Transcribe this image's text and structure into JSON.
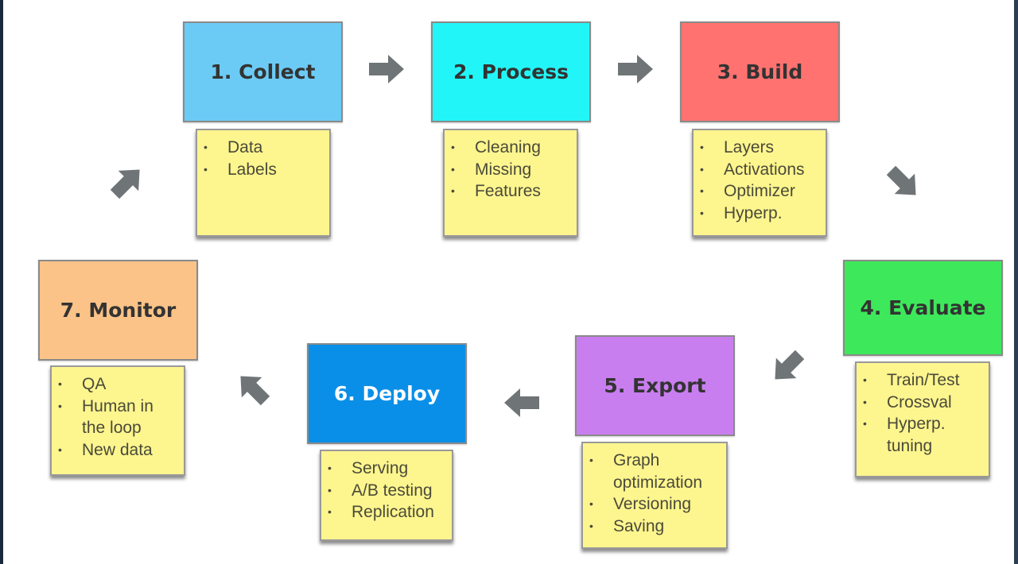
{
  "stages": [
    {
      "title": "1. Collect",
      "color": "#6ccbf5",
      "items": [
        "Data",
        "Labels"
      ]
    },
    {
      "title": "2. Process",
      "color": "#22f5f7",
      "items": [
        "Cleaning",
        "Missing",
        "Features"
      ]
    },
    {
      "title": "3. Build",
      "color": "#ff7270",
      "items": [
        "Layers",
        "Activations",
        "Optimizer",
        "Hyperp."
      ]
    },
    {
      "title": "4. Evaluate",
      "color": "#3de85a",
      "items": [
        "Train/Test",
        "Crossval",
        "Hyperp. tuning"
      ]
    },
    {
      "title": "5. Export",
      "color": "#c97ef0",
      "items": [
        "Graph optimization",
        "Versioning",
        "Saving"
      ]
    },
    {
      "title": "6. Deploy",
      "color": "#0a8fe8",
      "items": [
        "Serving",
        "A/B testing",
        "Replication"
      ]
    },
    {
      "title": "7. Monitor",
      "color": "#fbc387",
      "items": [
        "QA",
        "Human in the loop",
        "New data"
      ]
    }
  ],
  "note_color": "#fdf58e",
  "arrow_color": "#6f7476",
  "arrow_icon": "arrow-icon"
}
